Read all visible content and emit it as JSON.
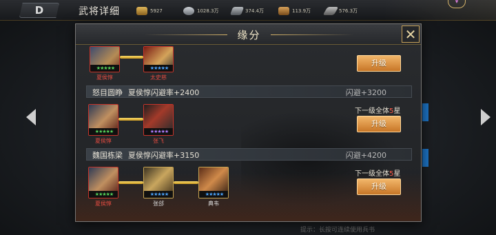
{
  "topbar": {
    "back_glyph": "D",
    "title": "武将详细",
    "resources": [
      {
        "icon": "gold-ingot-icon",
        "value": "5927",
        "color": "#c79a3a"
      },
      {
        "icon": "silver-coin-icon",
        "value": "1028.3万",
        "color": "#9aa0a8"
      },
      {
        "icon": "iron-icon",
        "value": "374.4万",
        "color": "#8b8f94"
      },
      {
        "icon": "food-bag-icon",
        "value": "113.9万",
        "color": "#b8823c"
      },
      {
        "icon": "wood-icon",
        "value": "576.3万",
        "color": "#8e8e8e"
      }
    ],
    "badge_glyph": "▾"
  },
  "hint": "提示：长按可连续使用兵书",
  "dialog": {
    "title": "缘分",
    "close_glyph": "✕",
    "upgrade_label": "升级",
    "rows": [
      {
        "heroes": [
          {
            "name": "夏侯惇",
            "stars": "★★★★★"
          },
          {
            "name": "太史慈",
            "stars": "★★★★★"
          }
        ]
      },
      {
        "name": "怒目圆睁",
        "desc": "夏侯惇闪避率+2400",
        "bonus": "闪避+3200",
        "next_prefix": "下一级全体",
        "next_num": "5",
        "next_suffix": "星",
        "heroes": [
          {
            "name": "夏侯惇",
            "stars": "★★★★★"
          },
          {
            "name": "张飞",
            "stars": "★★★★★"
          }
        ]
      },
      {
        "name": "魏国栋梁",
        "desc": "夏侯惇闪避率+3150",
        "bonus": "闪避+4200",
        "next_prefix": "下一级全体",
        "next_num": "5",
        "next_suffix": "星",
        "heroes": [
          {
            "name": "夏侯惇",
            "stars": "★★★★★"
          },
          {
            "name": "张郃",
            "stars": "★★★★★"
          },
          {
            "name": "典韦",
            "stars": "★★★★★"
          }
        ]
      }
    ]
  }
}
